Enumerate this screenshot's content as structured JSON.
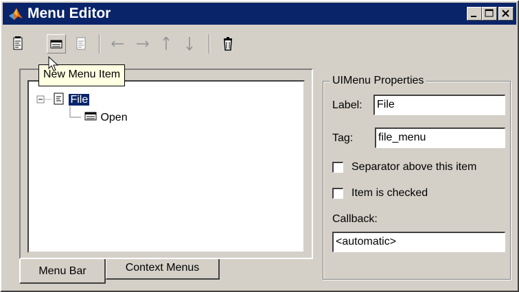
{
  "window": {
    "title": "Menu Editor"
  },
  "title_buttons": {
    "minimize": "_",
    "maximize": "□",
    "close": "×"
  },
  "toolbar": {
    "buttons": [
      {
        "icon": "new-menu-icon"
      },
      {
        "icon": "new-menu-item-icon"
      },
      {
        "icon": "new-context-menu-icon"
      },
      {
        "icon": "arrow-left-icon"
      },
      {
        "icon": "arrow-right-icon"
      },
      {
        "icon": "arrow-up-icon"
      },
      {
        "icon": "arrow-down-icon"
      },
      {
        "icon": "delete-icon"
      }
    ],
    "tooltip": "New Menu Item"
  },
  "tree": {
    "items": [
      {
        "label": "File",
        "selected": true,
        "icon": "menu-icon"
      },
      {
        "label": "Open",
        "selected": false,
        "icon": "menu-item-icon"
      }
    ]
  },
  "tabs": {
    "menu_bar": "Menu Bar",
    "context_menus": "Context Menus"
  },
  "properties": {
    "group_title": "UIMenu Properties",
    "label_caption": "Label:",
    "label_value": "File",
    "tag_caption": "Tag:",
    "tag_value": "file_menu",
    "separator_label": "Separator above this item",
    "separator_checked": false,
    "checked_label": "Item is checked",
    "checked_checked": false,
    "callback_caption": "Callback:",
    "callback_value": "<automatic>"
  },
  "colors": {
    "titlebar": "#0a246a",
    "face": "#d4d0c8",
    "tooltip": "#ffffe1"
  }
}
